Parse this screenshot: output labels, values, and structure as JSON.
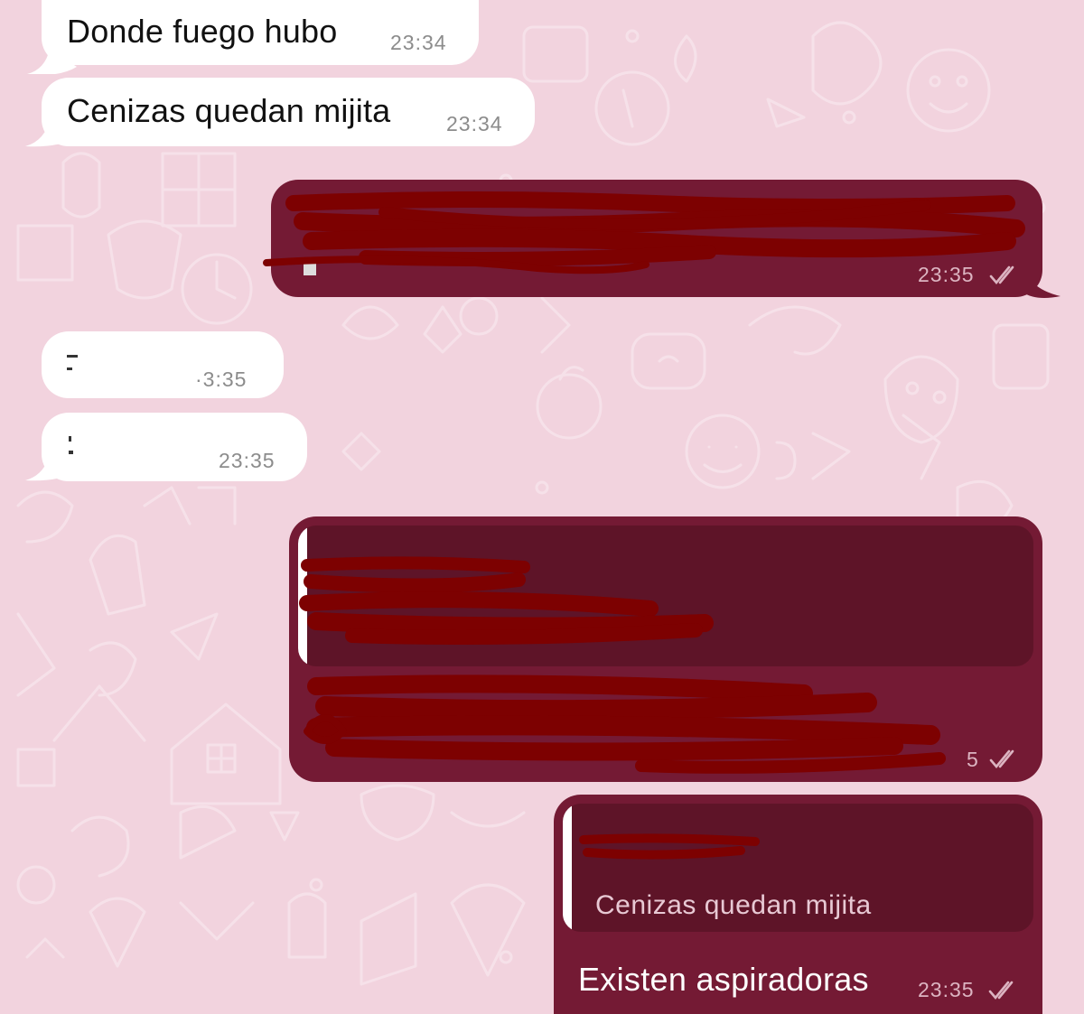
{
  "conversation": {
    "messages": [
      {
        "direction": "incoming",
        "text": "Donde fuego hubo",
        "time": "23:34"
      },
      {
        "direction": "incoming",
        "text": "Cenizas quedan mijita",
        "time": "23:34"
      },
      {
        "direction": "outgoing",
        "text": "",
        "time": "23:35",
        "redacted": true
      },
      {
        "direction": "incoming",
        "text": "",
        "time": "·3:35",
        "redacted": true
      },
      {
        "direction": "incoming",
        "text": "",
        "time": "23:35",
        "redacted": true
      },
      {
        "direction": "outgoing",
        "text": "",
        "time": "5",
        "redacted": true
      },
      {
        "direction": "outgoing",
        "text": "Existen aspiradoras",
        "time": "23:35",
        "reply_to": {
          "author": "",
          "text": "Cenizas quedan mijita"
        }
      }
    ]
  },
  "colors": {
    "background": "#f2d3de",
    "incoming_bubble": "#ffffff",
    "outgoing_bubble": "#741a34",
    "quote_box": "#5e1428",
    "scribble": "#7d0101"
  },
  "icons": {
    "read_receipt": "double-check-icon"
  }
}
